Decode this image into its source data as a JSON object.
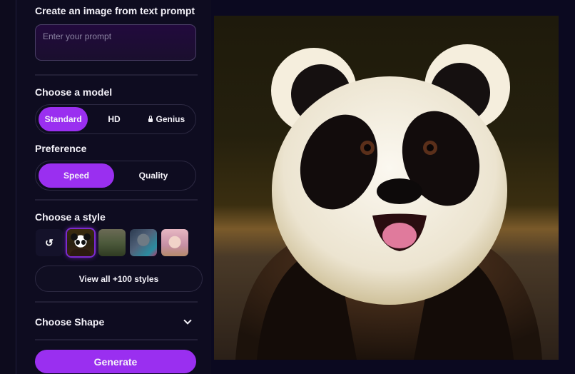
{
  "header": {
    "title": "Create an image from text prompt"
  },
  "prompt": {
    "value": "",
    "placeholder": "Enter your prompt"
  },
  "model": {
    "label": "Choose a model",
    "options": [
      {
        "label": "Standard",
        "active": true,
        "locked": false
      },
      {
        "label": "HD",
        "active": false,
        "locked": false
      },
      {
        "label": "Genius",
        "active": false,
        "locked": true
      }
    ]
  },
  "preference": {
    "label": "Preference",
    "options": [
      {
        "label": "Speed",
        "active": true
      },
      {
        "label": "Quality",
        "active": false
      }
    ]
  },
  "style": {
    "label": "Choose a style",
    "thumbs": [
      {
        "name": "no-style",
        "glyph": "↺"
      },
      {
        "name": "panda-style",
        "selected": true
      },
      {
        "name": "forest-style"
      },
      {
        "name": "robot-style"
      },
      {
        "name": "anime-girl-style"
      }
    ],
    "view_all_label": "View all +100 styles"
  },
  "shape": {
    "label": "Choose Shape"
  },
  "generate": {
    "label": "Generate"
  },
  "result": {
    "description": "Generated image of a smiling panda"
  },
  "colors": {
    "accent": "#9a2ff0",
    "background": "#0b0920"
  }
}
